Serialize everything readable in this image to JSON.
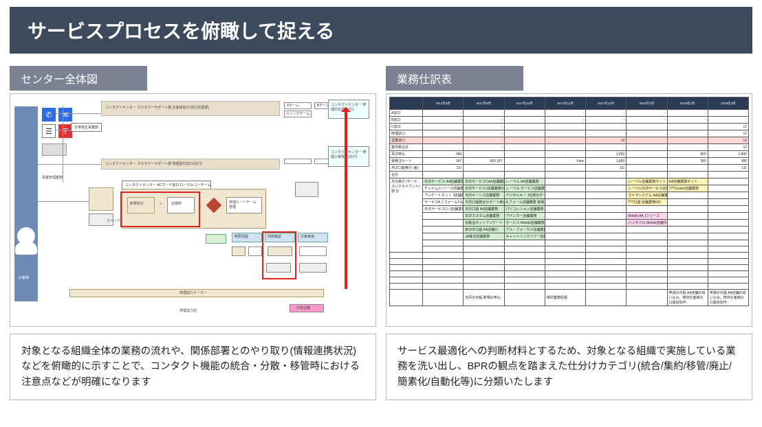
{
  "title": "サービスプロセスを俯瞰して捉える",
  "left": {
    "section_label": "センター全体図",
    "description": "対象となる組織全体の業務の流れや、関係部署とのやり取り(情報連携状況)などを俯瞰的に示すことで、コンタクト機能の統合・分散・移管時における注意点などが明確になります",
    "boxes": {
      "header_a": "コンタクトセンター カスタマーサポート部 お客様窓口(先行処置部)",
      "header_b": "コンタクトセンター カスタマーサポート部 修理受付窓口(先行)",
      "chip1": "Aチーム",
      "chip2": "Bチーム",
      "chip3": "Cリングチーム",
      "right_top": "コンタクトセンター 修理対応部(先行)",
      "right_bot": "コンタクトセンター 修理工場事業(先行)",
      "subteam": "コンタクトセンター ACカード窓口 ローカルコーチーム",
      "client_stub": "日常発生事業部",
      "customer": "お客様",
      "node_a": "新規受付",
      "node_b": "定期修",
      "node_c": "修理ルートチーム 管理",
      "bl_a": "概要把握",
      "bl_b": "問題確認",
      "bl_c": "対策実施",
      "footer": "修理協力メーカー",
      "foot_sub": "修理協力店",
      "ext": "対象店舗"
    }
  },
  "right": {
    "section_label": "業務仕訳表",
    "description": "サービス最適化への判断材料とするため、対象となる組織で実施している業務を洗い出し、BPRの観点を踏まえた仕分けカテゴリ(統合/集約/移管/廃止/簡素化/自動化等)に分類いたします",
    "table": {
      "headers": [
        "",
        "2017年8月",
        "2017年9月",
        "2017年10月",
        "2017年11月",
        "2017年12月",
        "2018年1月",
        "2018年2月",
        "2018年3月"
      ],
      "rows": [
        {
          "label": "A窓口",
          "cells": [
            "-",
            "-",
            "-",
            "-",
            "-",
            "-",
            "-",
            "-"
          ]
        },
        {
          "label": "B窓口",
          "cells": [
            "-",
            "-",
            "-",
            "-",
            "-",
            "-",
            "-",
            "-"
          ]
        },
        {
          "label": "C窓口",
          "cells": [
            "",
            "-",
            "",
            "",
            "",
            "",
            "",
            "12"
          ]
        },
        {
          "label": "修理窓口",
          "cells": [
            "",
            "-",
            "",
            "",
            "",
            "",
            "",
            "12"
          ]
        },
        {
          "label": "営業窓口",
          "cells": [
            "",
            "-",
            "",
            "",
            "10",
            "",
            "",
            "12"
          ],
          "row_class": "row-red"
        },
        {
          "label": "案件数合計",
          "cells": [
            "",
            "-",
            "",
            "",
            "",
            "",
            "",
            "12"
          ]
        },
        {
          "label": "月次申込",
          "cells": [
            "380",
            "",
            "",
            "",
            "1,000",
            "",
            "800",
            "1,800"
          ]
        },
        {
          "label": "受発注ルート",
          "cells": [
            "187",
            "800  187",
            "",
            "View",
            "1,800",
            "",
            "380",
            "380"
          ]
        },
        {
          "label": "月次口座移行 (金)",
          "cells": [
            "111",
            "",
            "",
            "",
            "111",
            "",
            "",
            "111"
          ]
        },
        {
          "label": "合計",
          "cells": [
            "",
            "",
            "",
            "",
            "",
            "",
            "",
            ""
          ]
        },
        {
          "label": "月次移行 (サービス) (クライアント) 部   計",
          "rowspan": 11,
          "cells_rows": [
            [
              {
                "t": "日次サービス AA店舗業務",
                "c": "c-green"
              },
              {
                "t": "日次サービスCAA店舗業務",
                "c": "c-green"
              },
              {
                "t": "レーベル AA店舗業務",
                "c": "c-green"
              },
              "",
              "",
              {
                "t": "レーベル店舗業務ネット",
                "c": "c-yellow"
              },
              {
                "t": "AA店舗業務ネット",
                "c": "c-yellow"
              }
            ],
            [
              {
                "t": "チャイムJシリーズ店舗業務OO",
                "c": ""
              },
              {
                "t": "日次サービスJ店舗業務OO",
                "c": "c-green"
              },
              {
                "t": "レーベル サービス店舗業務",
                "c": "c-green"
              },
              "",
              "",
              {
                "t": "レーベル日次サービス店舗業務",
                "c": "c-yellow"
              },
              {
                "t": "???Center店舗業務",
                "c": "c-yellow"
              }
            ],
            [
              {
                "t": "アンケートネット J店舗業務",
                "c": ""
              },
              {
                "t": "日次キーシス店舗業務",
                "c": "c-green"
              },
              {
                "t": "デジタルキー J社統合サービス",
                "c": "c-green"
              },
              "",
              "",
              {
                "t": "カメラシステム AA店舗業務",
                "c": "c-yellow"
              },
              ""
            ],
            [
              {
                "t": "サービスA J フォームTx店舗業務",
                "c": ""
              },
              {
                "t": "日次口座統合サポート統合業務",
                "c": "c-green"
              },
              {
                "t": "A フォーム店舗業務 家電・デジタルテレビ店舗業務 AA",
                "c": "c-green"
              },
              "",
              "",
              {
                "t": "???口座 店舗業務OO",
                "c": "c-yellow"
              },
              ""
            ],
            [
              {
                "t": "日次サービスCr J店舗業務 当Center窓",
                "c": ""
              },
              {
                "t": "日次口座 AA店舗業務",
                "c": "c-green"
              },
              {
                "t": "パリコレション店舗業務",
                "c": "c-green"
              },
              "",
              "",
              "",
              ""
            ],
            [
              "",
              {
                "t": "日次カスタム店舗業務",
                "c": "c-green"
              },
              {
                "t": "アインカー店舗業務",
                "c": "c-green"
              },
              "",
              "",
              {
                "t": "Mobile AA Jシリーズ",
                "c": "c-pink"
              },
              ""
            ],
            [
              "",
              {
                "t": "化粧品ネットアンケート",
                "c": "c-green"
              },
              {
                "t": "サービス Mobile店舗業務",
                "c": "c-green"
              },
              "",
              "",
              {
                "t": "バンザクロ Mobile店舗ネット",
                "c": "c-pink"
              },
              ""
            ],
            [
              "",
              {
                "t": "新日本口座 AA店舗口",
                "c": "c-green"
              },
              {
                "t": "アル・フォーカス店舗業務",
                "c": "c-green"
              },
              "",
              "",
              "",
              ""
            ],
            [
              "",
              {
                "t": "JA株式店舗業務",
                "c": "c-green"
              },
              {
                "t": "キャットリックツアー店舗業務",
                "c": "c-green"
              },
              "",
              "",
              "",
              ""
            ],
            [
              "",
              "",
              "",
              "",
              "",
              "",
              ""
            ],
            [
              "",
              "",
              "",
              "",
              "",
              "",
              ""
            ]
          ]
        }
      ],
      "footer_rows": [
        {
          "label": "",
          "cells": [
            "",
            "当月の日程 新規の申込-",
            "",
            "相対業務処理-",
            "",
            "",
            "申請の日程 AA店舗の追い込み、既存お客様の口座追加作-",
            "申請の日程 AA店舗の追い込み、既存お客様の口座追加作-"
          ]
        }
      ]
    }
  }
}
